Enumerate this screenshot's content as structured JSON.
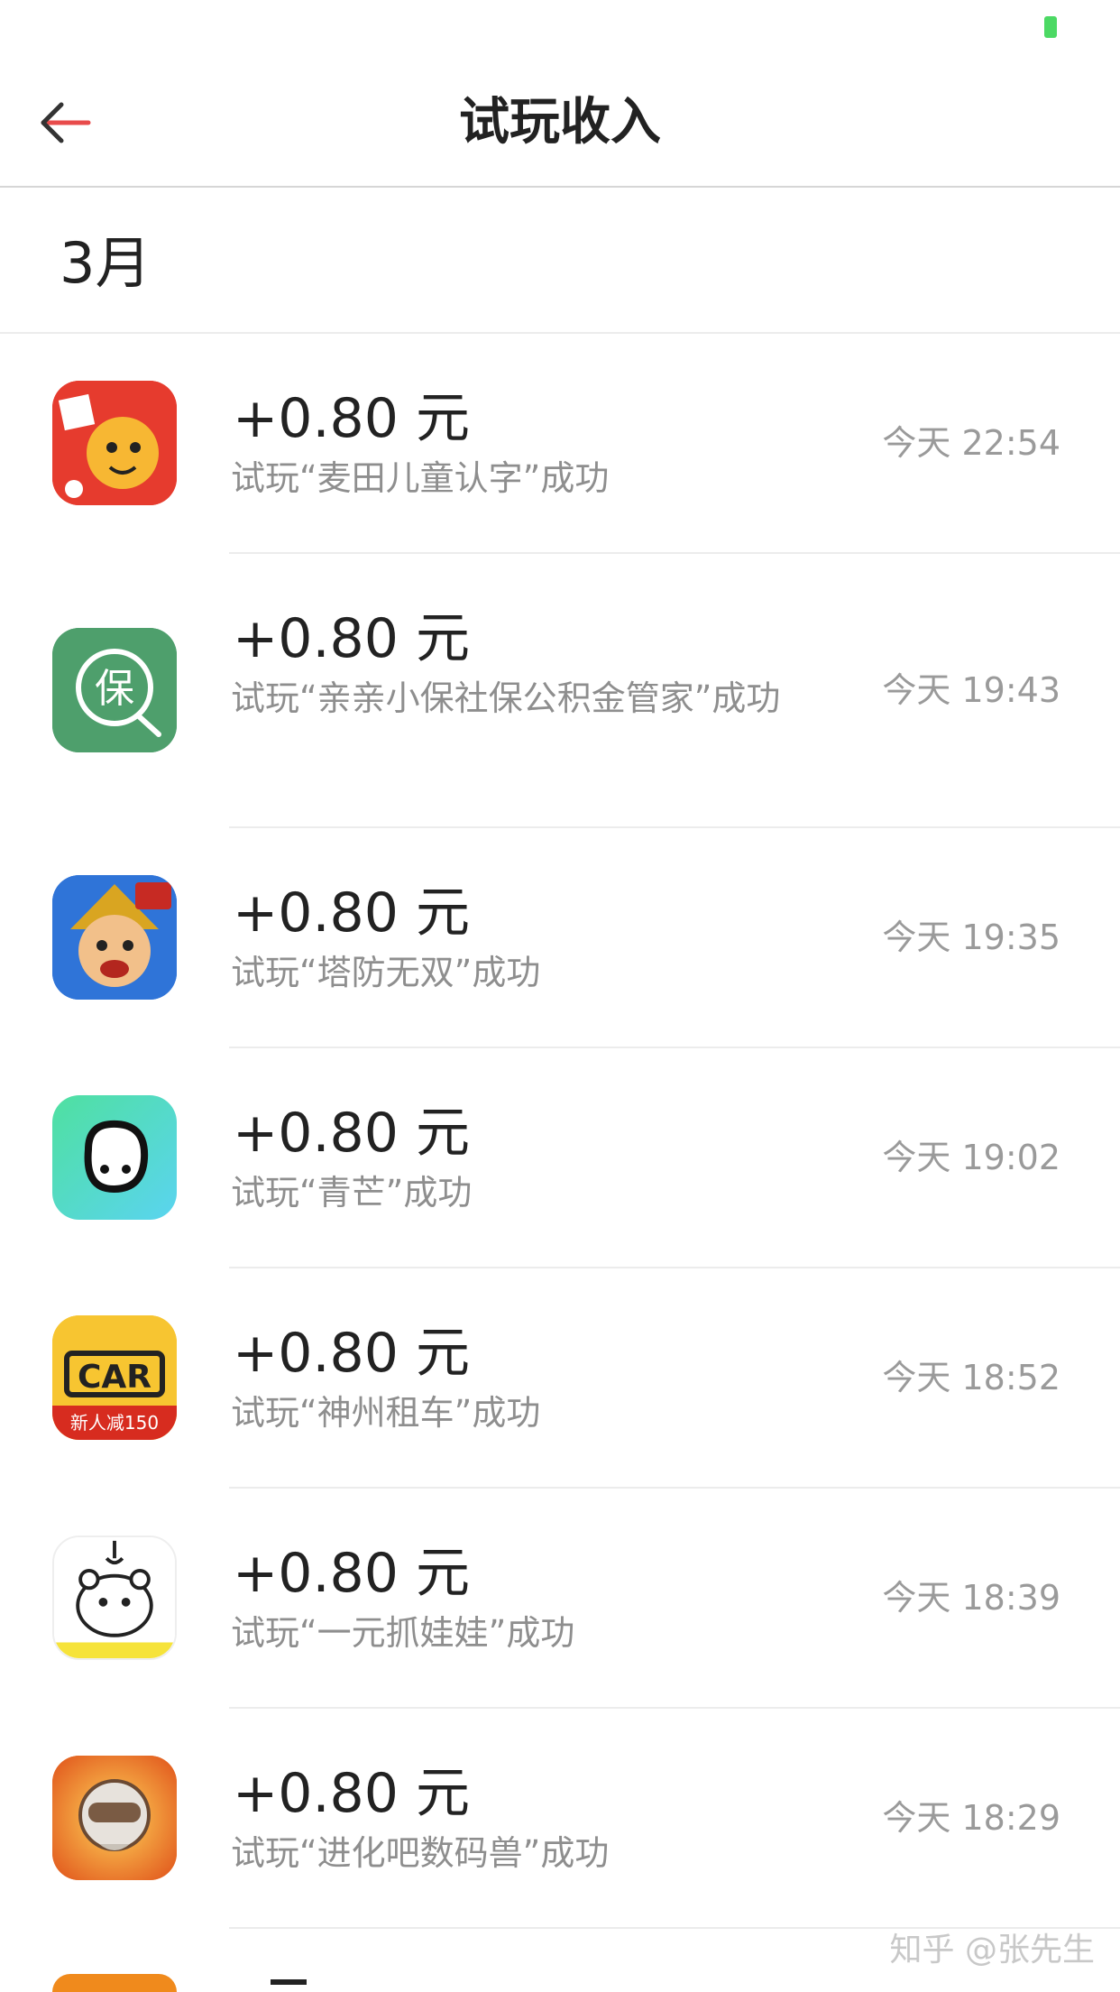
{
  "nav": {
    "title": "试玩收入"
  },
  "month": "3月",
  "records": [
    {
      "amount": "+0.80 元",
      "desc": "试玩“麦田儿童认字”成功",
      "time": "今天 22:54",
      "icon": "maitian-icon",
      "color": "#e8392c"
    },
    {
      "amount": "+0.80 元",
      "desc": "试玩“亲亲小保社保公积金管家”成功",
      "time": "今天 19:43",
      "icon": "qinqin-xiaobao-icon",
      "color": "#4a9e6b"
    },
    {
      "amount": "+0.80 元",
      "desc": "试玩“塔防无双”成功",
      "time": "今天 19:35",
      "icon": "tafang-wushuang-icon",
      "color": "#2a6fd6"
    },
    {
      "amount": "+0.80 元",
      "desc": "试玩“青芒”成功",
      "time": "今天 19:02",
      "icon": "qingmang-icon",
      "color": "#4fe0b4"
    },
    {
      "amount": "+0.80 元",
      "desc": "试玩“神州租车”成功",
      "time": "今天 18:52",
      "icon": "shenzhou-car-icon",
      "color": "#f7c531",
      "badge": "新人减150"
    },
    {
      "amount": "+0.80 元",
      "desc": "试玩“一元抓娃娃”成功",
      "time": "今天 18:39",
      "icon": "zhuawawa-icon",
      "color": "#ffffff"
    },
    {
      "amount": "+0.80 元",
      "desc": "试玩“进化吧数码兽”成功",
      "time": "今天 18:29",
      "icon": "shumashou-icon",
      "color": "#f07a1e"
    }
  ],
  "watermark": "知乎 @张先生"
}
